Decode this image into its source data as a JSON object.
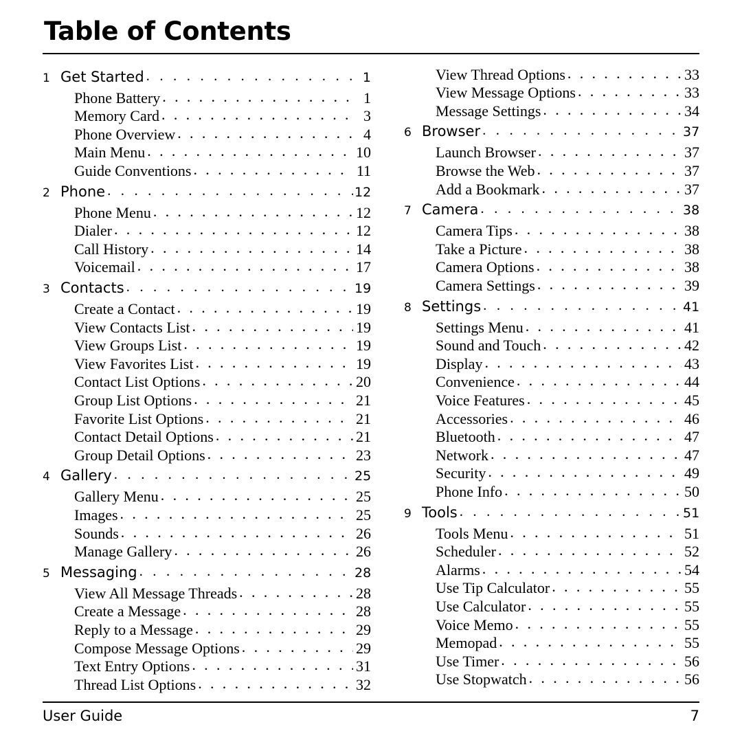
{
  "document": {
    "title": "Table of Contents",
    "footer_left": "User Guide",
    "footer_right": "7",
    "leader_dots": ". . . . . . . . . . . . . . . . . . . . . . . . . . . . . . . . . . . . . . . . . . . . . . . . . . . . . . . . . . . ."
  },
  "columns": [
    {
      "entries": [
        {
          "type": "chapter",
          "number": "1",
          "label": "Get Started",
          "page": "1"
        },
        {
          "type": "sub",
          "label": "Phone Battery",
          "page": "1"
        },
        {
          "type": "sub",
          "label": "Memory Card",
          "page": "3"
        },
        {
          "type": "sub",
          "label": "Phone Overview",
          "page": "4"
        },
        {
          "type": "sub",
          "label": "Main Menu",
          "page": "10"
        },
        {
          "type": "sub",
          "label": "Guide Conventions",
          "page": "11"
        },
        {
          "type": "chapter",
          "number": "2",
          "label": "Phone",
          "page": "12"
        },
        {
          "type": "sub",
          "label": "Phone Menu",
          "page": "12"
        },
        {
          "type": "sub",
          "label": "Dialer",
          "page": "12"
        },
        {
          "type": "sub",
          "label": "Call History",
          "page": "14"
        },
        {
          "type": "sub",
          "label": "Voicemail",
          "page": "17"
        },
        {
          "type": "chapter",
          "number": "3",
          "label": "Contacts",
          "page": "19"
        },
        {
          "type": "sub",
          "label": "Create a Contact",
          "page": "19"
        },
        {
          "type": "sub",
          "label": "View Contacts List",
          "page": "19"
        },
        {
          "type": "sub",
          "label": "View Groups List",
          "page": "19"
        },
        {
          "type": "sub",
          "label": "View Favorites List",
          "page": "19"
        },
        {
          "type": "sub",
          "label": "Contact List Options",
          "page": "20"
        },
        {
          "type": "sub",
          "label": "Group List Options",
          "page": "21"
        },
        {
          "type": "sub",
          "label": "Favorite List Options",
          "page": "21"
        },
        {
          "type": "sub",
          "label": "Contact Detail Options",
          "page": "21"
        },
        {
          "type": "sub",
          "label": "Group Detail Options",
          "page": "23"
        },
        {
          "type": "chapter",
          "number": "4",
          "label": "Gallery",
          "page": "25"
        },
        {
          "type": "sub",
          "label": "Gallery Menu",
          "page": "25"
        },
        {
          "type": "sub",
          "label": "Images",
          "page": "25"
        },
        {
          "type": "sub",
          "label": "Sounds",
          "page": "26"
        },
        {
          "type": "sub",
          "label": "Manage Gallery",
          "page": "26"
        },
        {
          "type": "chapter",
          "number": "5",
          "label": "Messaging",
          "page": "28"
        },
        {
          "type": "sub",
          "label": "View All Message Threads",
          "page": "28"
        },
        {
          "type": "sub",
          "label": "Create a Message",
          "page": "28"
        },
        {
          "type": "sub",
          "label": "Reply to a Message",
          "page": "29"
        },
        {
          "type": "sub",
          "label": "Compose Message Options",
          "page": "29"
        },
        {
          "type": "sub",
          "label": "Text Entry Options",
          "page": "31"
        },
        {
          "type": "sub",
          "label": "Thread List Options",
          "page": "32"
        }
      ]
    },
    {
      "entries": [
        {
          "type": "sub",
          "label": "View Thread Options",
          "page": "33"
        },
        {
          "type": "sub",
          "label": "View Message Options",
          "page": "33"
        },
        {
          "type": "sub",
          "label": "Message Settings",
          "page": "34"
        },
        {
          "type": "chapter",
          "number": "6",
          "label": "Browser",
          "page": "37"
        },
        {
          "type": "sub",
          "label": "Launch Browser",
          "page": "37"
        },
        {
          "type": "sub",
          "label": "Browse the Web",
          "page": "37"
        },
        {
          "type": "sub",
          "label": "Add a Bookmark",
          "page": "37"
        },
        {
          "type": "chapter",
          "number": "7",
          "label": "Camera",
          "page": "38"
        },
        {
          "type": "sub",
          "label": "Camera Tips",
          "page": "38"
        },
        {
          "type": "sub",
          "label": "Take a Picture",
          "page": "38"
        },
        {
          "type": "sub",
          "label": "Camera Options",
          "page": "38"
        },
        {
          "type": "sub",
          "label": "Camera Settings",
          "page": "39"
        },
        {
          "type": "chapter",
          "number": "8",
          "label": "Settings",
          "page": "41"
        },
        {
          "type": "sub",
          "label": "Settings Menu",
          "page": "41"
        },
        {
          "type": "sub",
          "label": "Sound and Touch",
          "page": "42"
        },
        {
          "type": "sub",
          "label": "Display",
          "page": "43"
        },
        {
          "type": "sub",
          "label": "Convenience",
          "page": "44"
        },
        {
          "type": "sub",
          "label": "Voice Features",
          "page": "45"
        },
        {
          "type": "sub",
          "label": "Accessories",
          "page": "46"
        },
        {
          "type": "sub",
          "label": "Bluetooth",
          "page": "47"
        },
        {
          "type": "sub",
          "label": "Network",
          "page": "47"
        },
        {
          "type": "sub",
          "label": "Security",
          "page": "49"
        },
        {
          "type": "sub",
          "label": "Phone Info",
          "page": "50"
        },
        {
          "type": "chapter",
          "number": "9",
          "label": "Tools",
          "page": "51"
        },
        {
          "type": "sub",
          "label": "Tools Menu",
          "page": "51"
        },
        {
          "type": "sub",
          "label": "Scheduler",
          "page": "52"
        },
        {
          "type": "sub",
          "label": "Alarms",
          "page": "54"
        },
        {
          "type": "sub",
          "label": "Use Tip Calculator",
          "page": "55"
        },
        {
          "type": "sub",
          "label": "Use Calculator",
          "page": "55"
        },
        {
          "type": "sub",
          "label": "Voice Memo",
          "page": "55"
        },
        {
          "type": "sub",
          "label": "Memopad",
          "page": "55"
        },
        {
          "type": "sub",
          "label": "Use Timer",
          "page": "56"
        },
        {
          "type": "sub",
          "label": "Use Stopwatch",
          "page": "56"
        }
      ]
    }
  ]
}
